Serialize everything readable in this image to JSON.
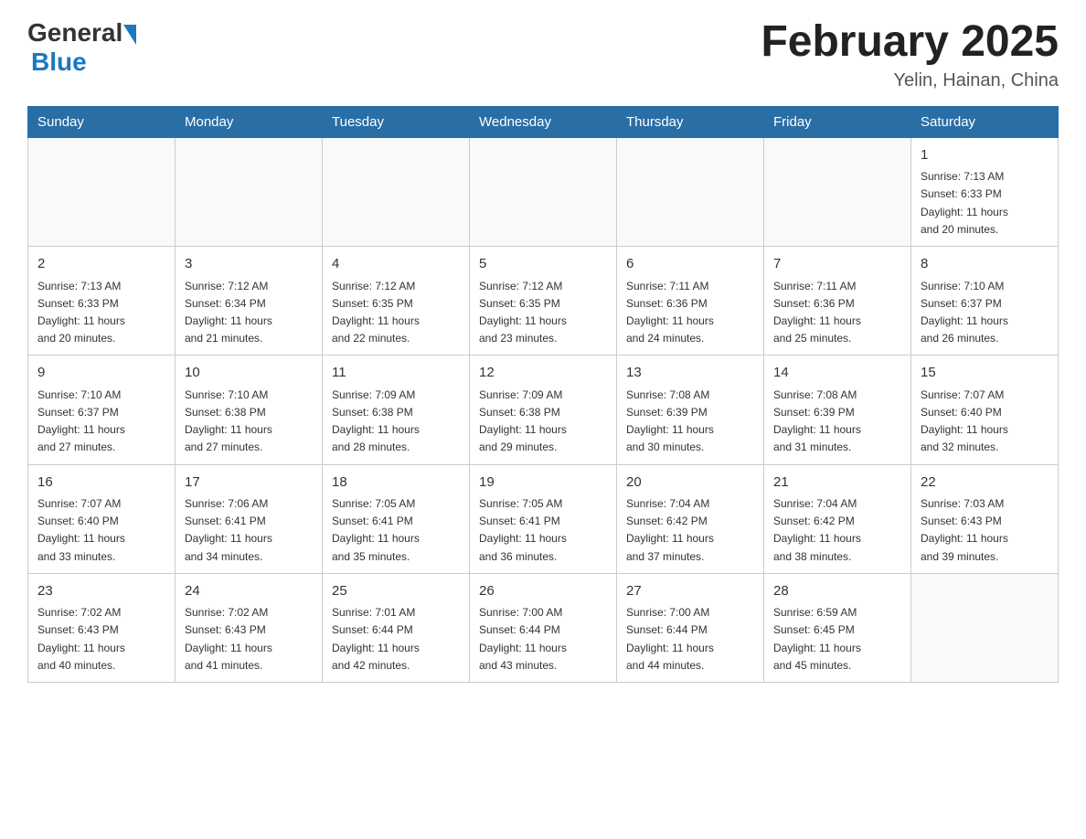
{
  "header": {
    "logo_general": "General",
    "logo_blue": "Blue",
    "month_title": "February 2025",
    "location": "Yelin, Hainan, China"
  },
  "weekdays": [
    "Sunday",
    "Monday",
    "Tuesday",
    "Wednesday",
    "Thursday",
    "Friday",
    "Saturday"
  ],
  "weeks": [
    [
      {
        "day": "",
        "info": ""
      },
      {
        "day": "",
        "info": ""
      },
      {
        "day": "",
        "info": ""
      },
      {
        "day": "",
        "info": ""
      },
      {
        "day": "",
        "info": ""
      },
      {
        "day": "",
        "info": ""
      },
      {
        "day": "1",
        "info": "Sunrise: 7:13 AM\nSunset: 6:33 PM\nDaylight: 11 hours\nand 20 minutes."
      }
    ],
    [
      {
        "day": "2",
        "info": "Sunrise: 7:13 AM\nSunset: 6:33 PM\nDaylight: 11 hours\nand 20 minutes."
      },
      {
        "day": "3",
        "info": "Sunrise: 7:12 AM\nSunset: 6:34 PM\nDaylight: 11 hours\nand 21 minutes."
      },
      {
        "day": "4",
        "info": "Sunrise: 7:12 AM\nSunset: 6:35 PM\nDaylight: 11 hours\nand 22 minutes."
      },
      {
        "day": "5",
        "info": "Sunrise: 7:12 AM\nSunset: 6:35 PM\nDaylight: 11 hours\nand 23 minutes."
      },
      {
        "day": "6",
        "info": "Sunrise: 7:11 AM\nSunset: 6:36 PM\nDaylight: 11 hours\nand 24 minutes."
      },
      {
        "day": "7",
        "info": "Sunrise: 7:11 AM\nSunset: 6:36 PM\nDaylight: 11 hours\nand 25 minutes."
      },
      {
        "day": "8",
        "info": "Sunrise: 7:10 AM\nSunset: 6:37 PM\nDaylight: 11 hours\nand 26 minutes."
      }
    ],
    [
      {
        "day": "9",
        "info": "Sunrise: 7:10 AM\nSunset: 6:37 PM\nDaylight: 11 hours\nand 27 minutes."
      },
      {
        "day": "10",
        "info": "Sunrise: 7:10 AM\nSunset: 6:38 PM\nDaylight: 11 hours\nand 27 minutes."
      },
      {
        "day": "11",
        "info": "Sunrise: 7:09 AM\nSunset: 6:38 PM\nDaylight: 11 hours\nand 28 minutes."
      },
      {
        "day": "12",
        "info": "Sunrise: 7:09 AM\nSunset: 6:38 PM\nDaylight: 11 hours\nand 29 minutes."
      },
      {
        "day": "13",
        "info": "Sunrise: 7:08 AM\nSunset: 6:39 PM\nDaylight: 11 hours\nand 30 minutes."
      },
      {
        "day": "14",
        "info": "Sunrise: 7:08 AM\nSunset: 6:39 PM\nDaylight: 11 hours\nand 31 minutes."
      },
      {
        "day": "15",
        "info": "Sunrise: 7:07 AM\nSunset: 6:40 PM\nDaylight: 11 hours\nand 32 minutes."
      }
    ],
    [
      {
        "day": "16",
        "info": "Sunrise: 7:07 AM\nSunset: 6:40 PM\nDaylight: 11 hours\nand 33 minutes."
      },
      {
        "day": "17",
        "info": "Sunrise: 7:06 AM\nSunset: 6:41 PM\nDaylight: 11 hours\nand 34 minutes."
      },
      {
        "day": "18",
        "info": "Sunrise: 7:05 AM\nSunset: 6:41 PM\nDaylight: 11 hours\nand 35 minutes."
      },
      {
        "day": "19",
        "info": "Sunrise: 7:05 AM\nSunset: 6:41 PM\nDaylight: 11 hours\nand 36 minutes."
      },
      {
        "day": "20",
        "info": "Sunrise: 7:04 AM\nSunset: 6:42 PM\nDaylight: 11 hours\nand 37 minutes."
      },
      {
        "day": "21",
        "info": "Sunrise: 7:04 AM\nSunset: 6:42 PM\nDaylight: 11 hours\nand 38 minutes."
      },
      {
        "day": "22",
        "info": "Sunrise: 7:03 AM\nSunset: 6:43 PM\nDaylight: 11 hours\nand 39 minutes."
      }
    ],
    [
      {
        "day": "23",
        "info": "Sunrise: 7:02 AM\nSunset: 6:43 PM\nDaylight: 11 hours\nand 40 minutes."
      },
      {
        "day": "24",
        "info": "Sunrise: 7:02 AM\nSunset: 6:43 PM\nDaylight: 11 hours\nand 41 minutes."
      },
      {
        "day": "25",
        "info": "Sunrise: 7:01 AM\nSunset: 6:44 PM\nDaylight: 11 hours\nand 42 minutes."
      },
      {
        "day": "26",
        "info": "Sunrise: 7:00 AM\nSunset: 6:44 PM\nDaylight: 11 hours\nand 43 minutes."
      },
      {
        "day": "27",
        "info": "Sunrise: 7:00 AM\nSunset: 6:44 PM\nDaylight: 11 hours\nand 44 minutes."
      },
      {
        "day": "28",
        "info": "Sunrise: 6:59 AM\nSunset: 6:45 PM\nDaylight: 11 hours\nand 45 minutes."
      },
      {
        "day": "",
        "info": ""
      }
    ]
  ]
}
